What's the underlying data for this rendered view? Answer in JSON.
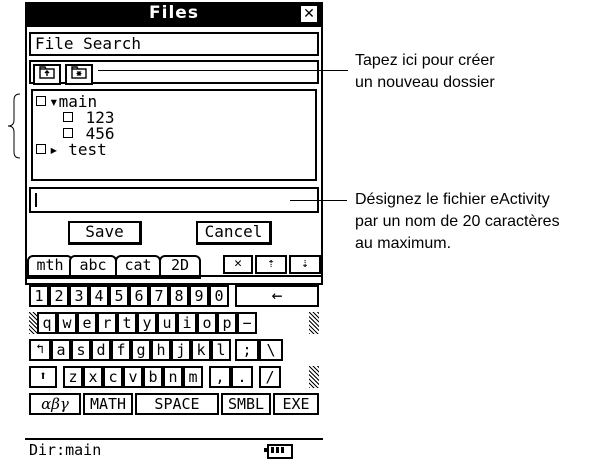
{
  "window": {
    "title": "Files",
    "close_icon": "close-icon"
  },
  "search": {
    "label": "File Search"
  },
  "toolbar": {
    "up_icon": "folder-up-icon",
    "new_folder_icon": "new-folder-icon"
  },
  "tree": {
    "items": [
      {
        "label": "main",
        "type": "folder-open"
      },
      {
        "label": "123",
        "type": "file"
      },
      {
        "label": "456",
        "type": "file"
      },
      {
        "label": "test",
        "type": "folder-closed"
      }
    ]
  },
  "filename": {
    "value": ""
  },
  "buttons": {
    "save": "Save",
    "cancel": "Cancel"
  },
  "tabs": [
    "mth",
    "abc",
    "cat",
    "2D"
  ],
  "tab_icons": [
    "close-keyboard-icon",
    "scroll-up-icon",
    "scroll-down-icon"
  ],
  "keyboard": {
    "row1": [
      "1",
      "2",
      "3",
      "4",
      "5",
      "6",
      "7",
      "8",
      "9",
      "0",
      "←"
    ],
    "row2": [
      "q",
      "w",
      "e",
      "r",
      "t",
      "y",
      "u",
      "i",
      "o",
      "p",
      "−"
    ],
    "row3": [
      "↰",
      "a",
      "s",
      "d",
      "f",
      "g",
      "h",
      "j",
      "k",
      "l",
      ";",
      "\\"
    ],
    "row4": [
      "⬆",
      "z",
      "x",
      "c",
      "v",
      "b",
      "n",
      "m",
      ",",
      ".",
      "/"
    ],
    "row5": [
      "αβγ",
      "MATH",
      "SPACE",
      "SMBL",
      "EXE"
    ]
  },
  "status": {
    "dir": "Dir:main"
  },
  "annotations": {
    "new_folder": [
      "Tapez ici pour créer",
      "un nouveau dossier"
    ],
    "filename": [
      "Désignez le fichier eActivity",
      "par un nom de 20 caractères",
      "au maximum."
    ]
  }
}
